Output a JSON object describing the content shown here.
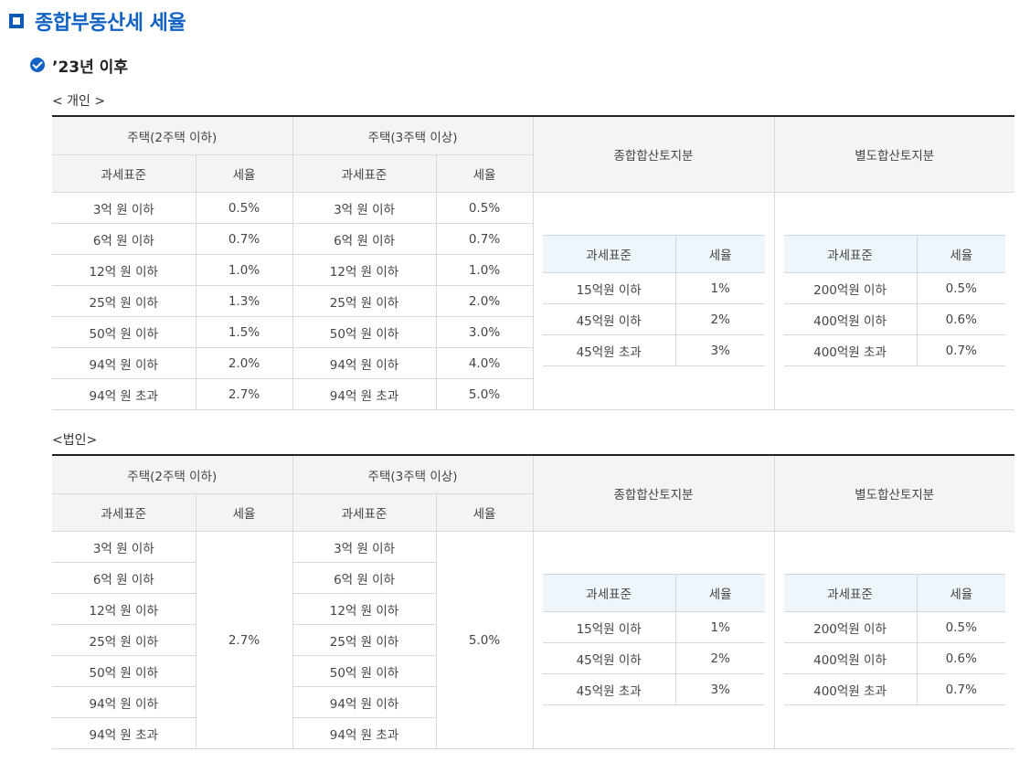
{
  "title": "종합부동산세 세율",
  "subtitle": "’23년 이후",
  "sections": [
    {
      "label": "< 개인 >",
      "headers": {
        "group_a": "주택(2주택 이하)",
        "group_b": "주택(3주택 이상)",
        "land_general": "종합합산토지분",
        "land_separate": "별도합산토지분",
        "base": "과세표준",
        "rate": "세율"
      },
      "housing_rows": [
        {
          "base_a": "3억 원 이하",
          "rate_a": "0.5%",
          "base_b": "3억 원 이하",
          "rate_b": "0.5%"
        },
        {
          "base_a": "6억 원 이하",
          "rate_a": "0.7%",
          "base_b": "6억 원 이하",
          "rate_b": "0.7%"
        },
        {
          "base_a": "12억 원 이하",
          "rate_a": "1.0%",
          "base_b": "12억 원 이하",
          "rate_b": "1.0%"
        },
        {
          "base_a": "25억 원 이하",
          "rate_a": "1.3%",
          "base_b": "25억 원 이하",
          "rate_b": "2.0%"
        },
        {
          "base_a": "50억 원 이하",
          "rate_a": "1.5%",
          "base_b": "50억 원 이하",
          "rate_b": "3.0%"
        },
        {
          "base_a": "94억 원 이하",
          "rate_a": "2.0%",
          "base_b": "94억 원 이하",
          "rate_b": "4.0%"
        },
        {
          "base_a": "94억 원 초과",
          "rate_a": "2.7%",
          "base_b": "94억 원 초과",
          "rate_b": "5.0%"
        }
      ],
      "land_general_rows": [
        {
          "base": "15억원 이하",
          "rate": "1%"
        },
        {
          "base": "45억원 이하",
          "rate": "2%"
        },
        {
          "base": "45억원 초과",
          "rate": "3%"
        }
      ],
      "land_separate_rows": [
        {
          "base": "200억원 이하",
          "rate": "0.5%"
        },
        {
          "base": "400억원 이하",
          "rate": "0.6%"
        },
        {
          "base": "400억원 초과",
          "rate": "0.7%"
        }
      ]
    },
    {
      "label": "<법인>",
      "headers": {
        "group_a": "주택(2주택 이하)",
        "group_b": "주택(3주택 이상)",
        "land_general": "종합합산토지분",
        "land_separate": "별도합산토지분",
        "base": "과세표준",
        "rate": "세율"
      },
      "housing_bases_a": [
        "3억 원 이하",
        "6억 원 이하",
        "12억 원 이하",
        "25억 원 이하",
        "50억 원 이하",
        "94억 원 이하",
        "94억 원 초과"
      ],
      "housing_bases_b": [
        "3억 원 이하",
        "6억 원 이하",
        "12억 원 이하",
        "25억 원 이하",
        "50억 원 이하",
        "94억 원 이하",
        "94억 원 초과"
      ],
      "flat_rate_a": "2.7%",
      "flat_rate_b": "5.0%",
      "land_general_rows": [
        {
          "base": "15억원 이하",
          "rate": "1%"
        },
        {
          "base": "45억원 이하",
          "rate": "2%"
        },
        {
          "base": "45억원 초과",
          "rate": "3%"
        }
      ],
      "land_separate_rows": [
        {
          "base": "200억원 이하",
          "rate": "0.5%"
        },
        {
          "base": "400억원 이하",
          "rate": "0.6%"
        },
        {
          "base": "400억원 초과",
          "rate": "0.7%"
        }
      ]
    }
  ]
}
